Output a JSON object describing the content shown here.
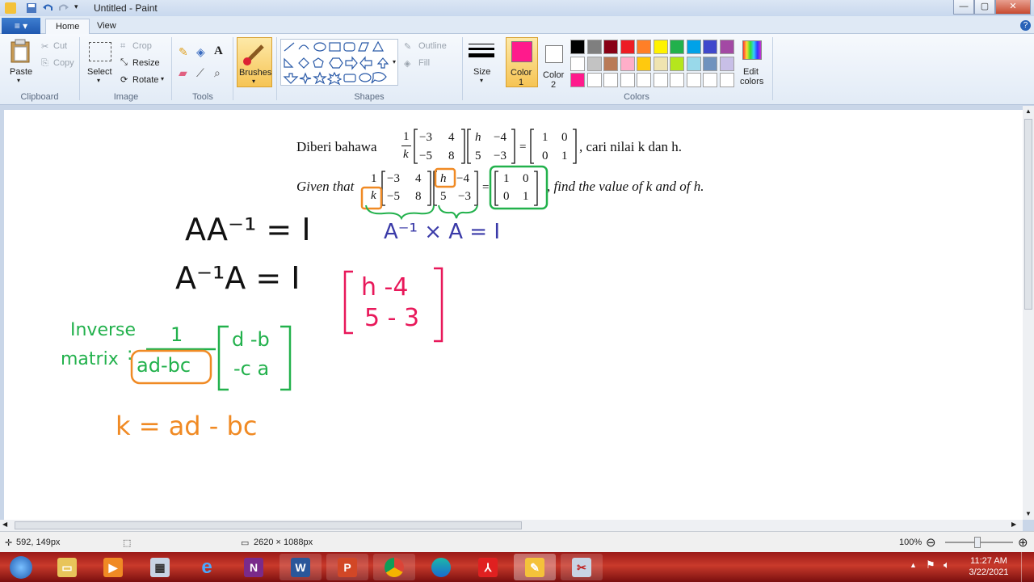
{
  "window": {
    "title": "Untitled - Paint",
    "minimize_glyph": "—",
    "maximize_glyph": "▢",
    "close_glyph": "✕"
  },
  "tabs": {
    "menu_glyph": "≡ ▾",
    "home": "Home",
    "view": "View"
  },
  "ribbon": {
    "clipboard": {
      "label": "Clipboard",
      "paste": "Paste",
      "cut": "Cut",
      "copy": "Copy"
    },
    "image": {
      "label": "Image",
      "select": "Select",
      "crop": "Crop",
      "resize": "Resize",
      "rotate": "Rotate"
    },
    "tools": {
      "label": "Tools"
    },
    "brushes": {
      "label": "Brushes"
    },
    "shapes": {
      "label": "Shapes",
      "outline": "Outline",
      "fill": "Fill"
    },
    "size": {
      "label": "Size"
    },
    "color1": {
      "label_line1": "Color",
      "label_line2": "1",
      "value": "#ff1a8c"
    },
    "color2": {
      "label_line1": "Color",
      "label_line2": "2",
      "value": "#ffffff"
    },
    "colors": {
      "label": "Colors",
      "edit_line1": "Edit",
      "edit_line2": "colors",
      "palette_row1": [
        "#000000",
        "#7f7f7f",
        "#880015",
        "#ed1c24",
        "#ff7f27",
        "#fff200",
        "#22b14c",
        "#00a2e8",
        "#3f48cc",
        "#a349a4"
      ],
      "palette_row2": [
        "#ffffff",
        "#c3c3c3",
        "#b97a57",
        "#ffaec9",
        "#ffc90e",
        "#efe4b0",
        "#b5e61d",
        "#99d9ea",
        "#7092be",
        "#c8bfe7"
      ],
      "palette_row3": [
        "#ff1a8c",
        "#ffffff",
        "#ffffff",
        "#ffffff",
        "#ffffff",
        "#ffffff",
        "#ffffff",
        "#ffffff",
        "#ffffff",
        "#ffffff"
      ]
    }
  },
  "canvas": {
    "problem_malay": {
      "lead": "Diberi bahawa",
      "frac_num": "1",
      "frac_den": "k",
      "m1": [
        "−3",
        "4",
        "−5",
        "8"
      ],
      "m2": [
        "h",
        "−4",
        "5",
        "−3"
      ],
      "eq": "=",
      "id": [
        "1",
        "0",
        "0",
        "1"
      ],
      "tail": ", cari nilai k dan h."
    },
    "problem_english": {
      "lead": "Given that",
      "frac_num": "1",
      "frac_den": "k",
      "m1": [
        "−3",
        "4",
        "−5",
        "8"
      ],
      "m2": [
        "h",
        "−4",
        "5",
        "−3"
      ],
      "eq": "=",
      "id": [
        "1",
        "0",
        "0",
        "1"
      ],
      "tail": ", find the value of k and of h."
    },
    "annotations": {
      "aai_line1": "AA⁻¹ = I",
      "aai_line2": "A⁻¹A  = I",
      "blue_eq": "A⁻¹ × A   =  I",
      "pink_row1": "h  -4",
      "pink_row2": "5  - 3",
      "inverse_word1": "Inverse",
      "inverse_word2": "matrix",
      "inverse_eq": ":",
      "inverse_num": "1",
      "inverse_den": "ad-bc",
      "adj_row1": "d -b",
      "adj_row2": "-c a",
      "k_eq": "k = ad - bc"
    }
  },
  "status": {
    "cursor_pos": "592, 149px",
    "image_size": "2620 × 1088px",
    "zoom": "100%",
    "zoom_out": "⊖",
    "zoom_in": "⊕"
  },
  "taskbar": {
    "time": "11:27 AM",
    "date": "3/22/2021",
    "apps": [
      "start",
      "explorer",
      "media",
      "calculator",
      "ie",
      "onenote",
      "word",
      "powerpoint",
      "chrome",
      "edge",
      "acrobat",
      "paint",
      "snipping"
    ]
  }
}
